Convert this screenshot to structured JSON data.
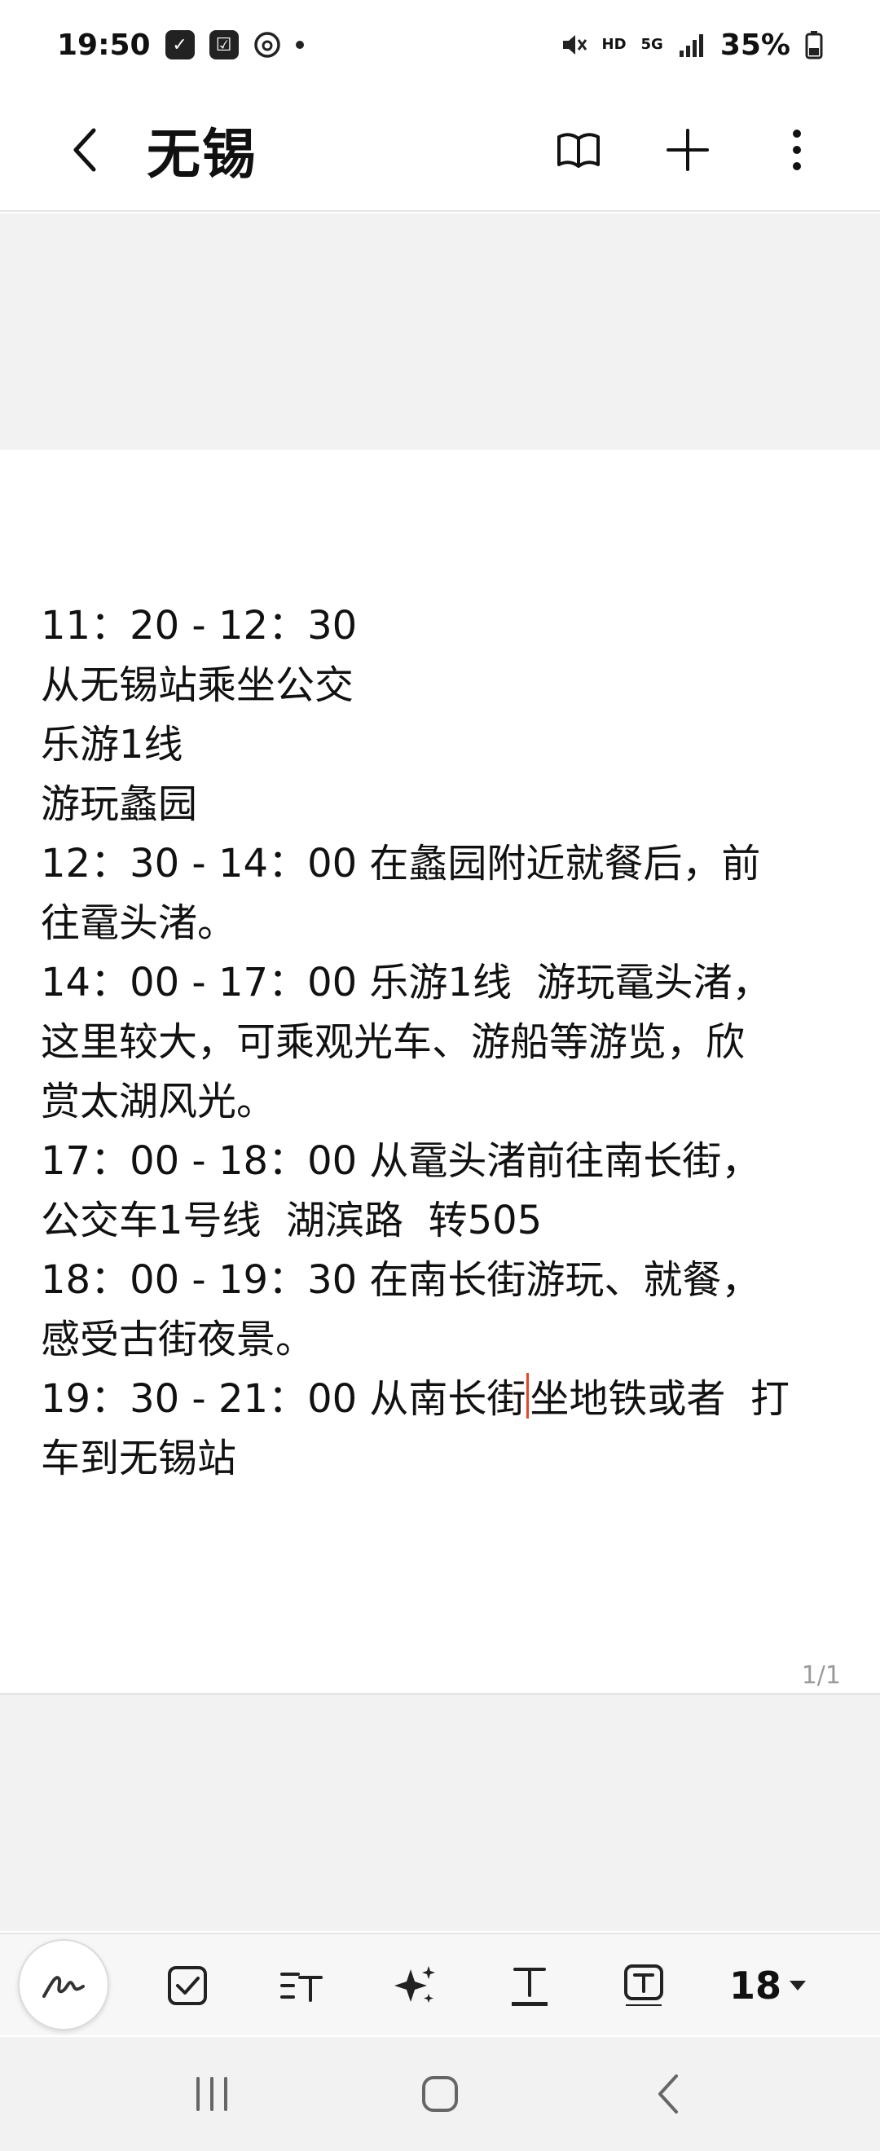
{
  "status_bar": {
    "time": "19:50",
    "battery": "35%",
    "network_hd": "HD",
    "network_5g": "5G"
  },
  "app_bar": {
    "title": "无锡"
  },
  "note": {
    "lines_before_cursor": [
      "11：20 - 12：30",
      "从无锡站乘坐公交",
      "乐游1线",
      "游玩蠡园",
      "12：30 - 14：00 在蠡园附近就餐后，前",
      "往鼋头渚。",
      "14：00 - 17：00 乐游1线  游玩鼋头渚，",
      "这里较大，可乘观光车、游船等游览，欣",
      "赏太湖风光。",
      "17：00 - 18：00 从鼋头渚前往南长街，",
      "公交车1号线  湖滨路  转505",
      "18：00 - 19：30 在南长街游玩、就餐，",
      "感受古街夜景。"
    ],
    "cursor_line_before": "19：30 - 21：00 从南长街",
    "cursor_line_after": "坐地铁或者  打",
    "last_line": "车到无锡站"
  },
  "page_indicator": "1/1",
  "toolbar": {
    "font_size": "18"
  }
}
